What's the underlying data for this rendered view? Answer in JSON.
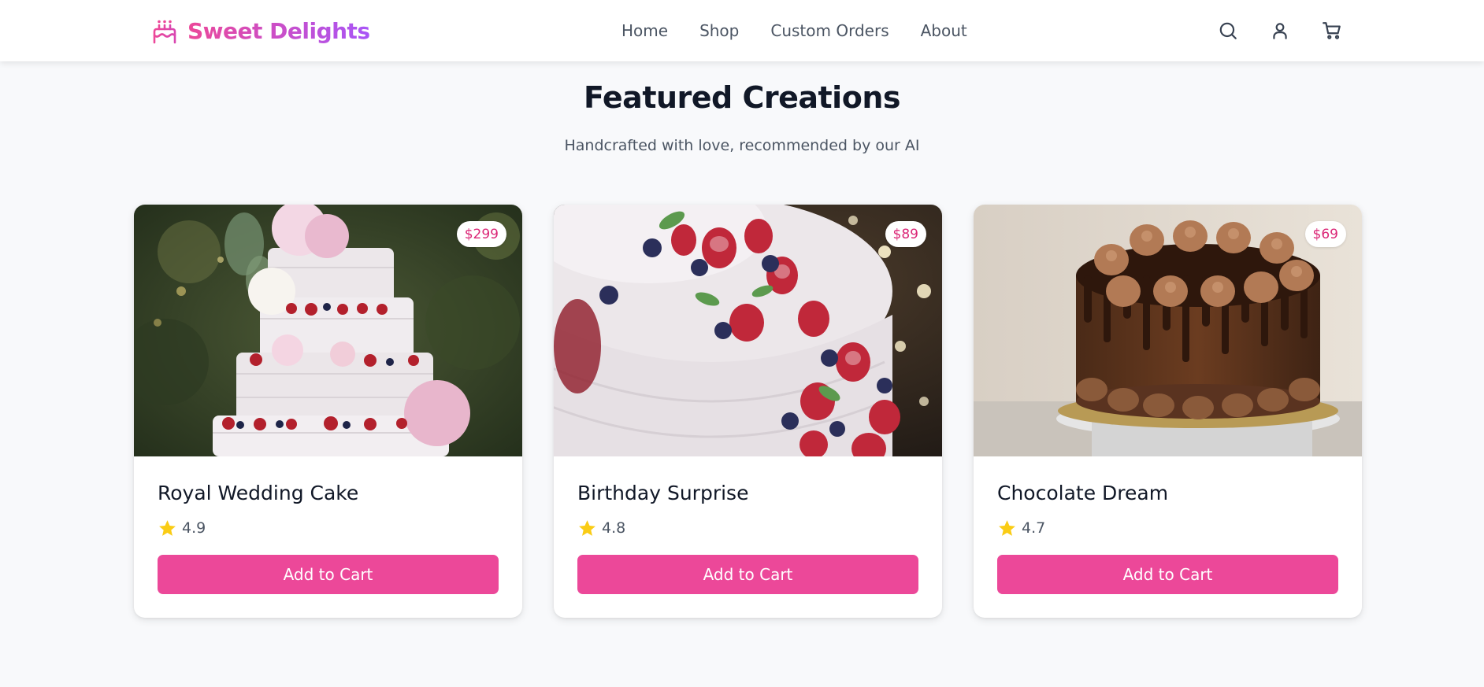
{
  "header": {
    "brand_name": "Sweet Delights",
    "brand_icon": "cake-icon",
    "nav": [
      "Home",
      "Shop",
      "Custom Orders",
      "About"
    ],
    "icons": [
      "search-icon",
      "user-icon",
      "cart-icon"
    ]
  },
  "section": {
    "title": "Featured Creations",
    "subtitle": "Handcrafted with love, recommended by our AI"
  },
  "products": [
    {
      "name": "Royal Wedding Cake",
      "price": "$299",
      "rating": "4.9",
      "button_label": "Add to Cart",
      "image": "white tiered wedding cake with berries and flowers"
    },
    {
      "name": "Birthday Surprise",
      "price": "$89",
      "rating": "4.8",
      "button_label": "Add to Cart",
      "image": "white frosted cake topped with berries"
    },
    {
      "name": "Chocolate Dream",
      "price": "$69",
      "rating": "4.7",
      "button_label": "Add to Cart",
      "image": "chocolate drip cake with piped swirls"
    }
  ],
  "colors": {
    "accent": "#ec4899",
    "brand_gradient_start": "#ec4899",
    "brand_gradient_end": "#a855f7",
    "price_text": "#db2777",
    "star": "#facc15",
    "background": "#f8f9fb"
  }
}
